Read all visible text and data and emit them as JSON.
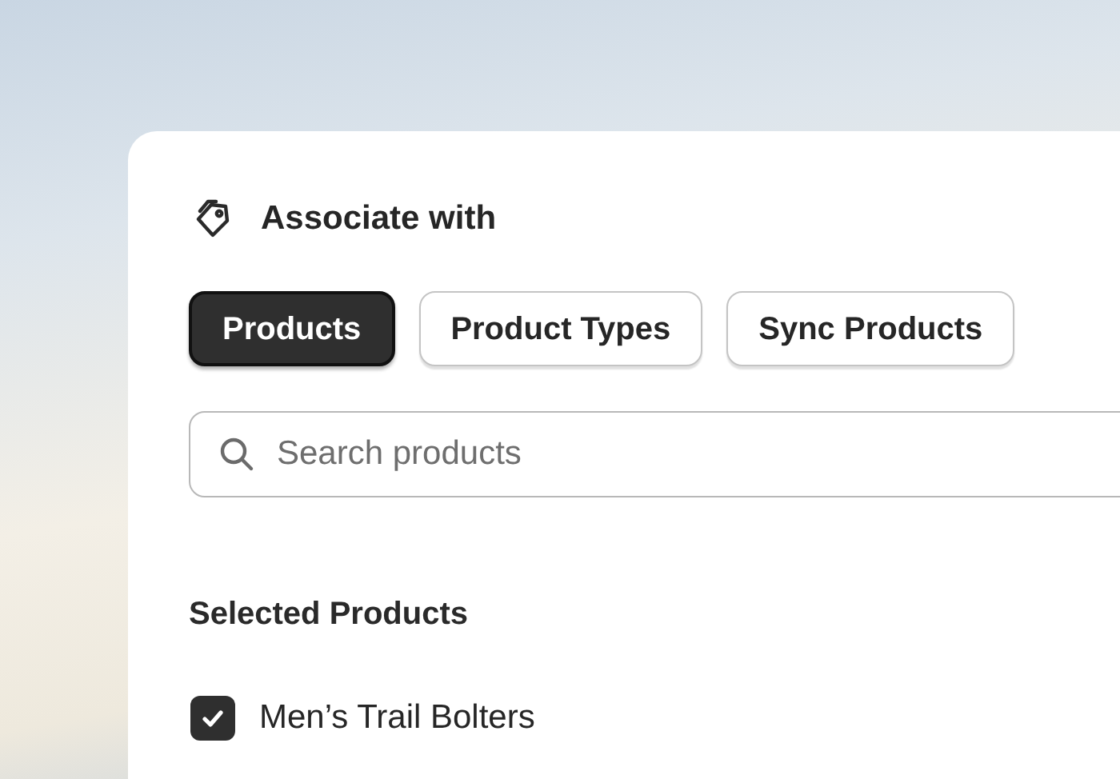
{
  "header": {
    "title": "Associate with"
  },
  "tabs": [
    {
      "label": "Products",
      "selected": true
    },
    {
      "label": "Product Types",
      "selected": false
    },
    {
      "label": "Sync Products",
      "selected": false
    }
  ],
  "search": {
    "placeholder": "Search products"
  },
  "section": {
    "title": "Selected Products"
  },
  "items": [
    {
      "label": "Men’s Trail Bolters",
      "checked": true
    }
  ]
}
